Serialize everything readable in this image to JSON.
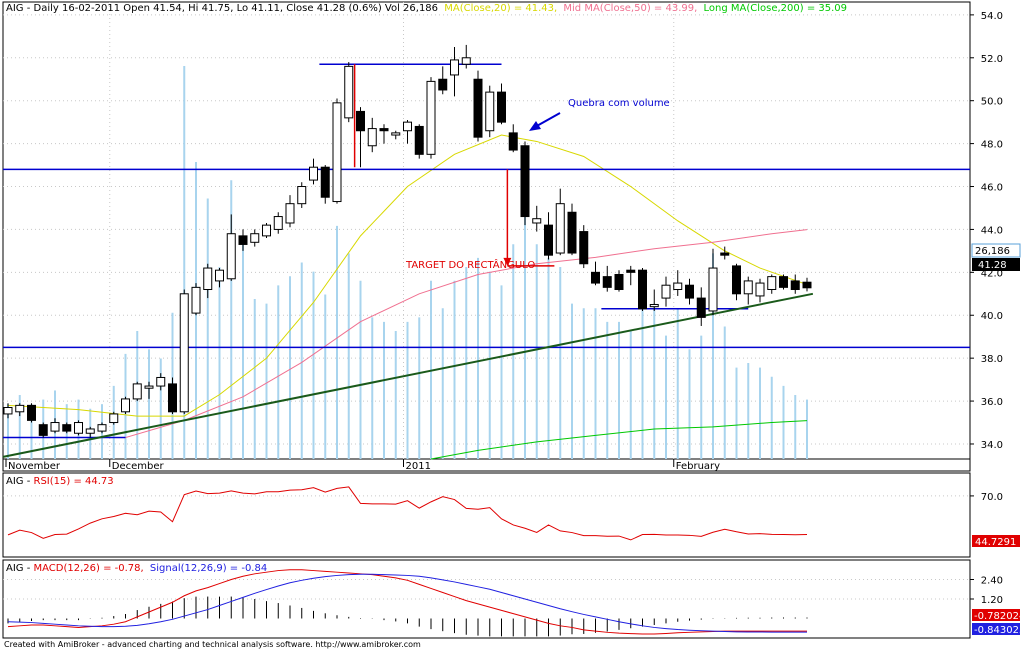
{
  "header": {
    "symbol": "AIG",
    "main_text": "AIG - Daily 16-02-2011 Open 41.54, Hi 41.75, Lo 41.11, Close 41.28 (0.6%) Vol 26,186",
    "ma_short_text": "MA(Close,20) = 41.43,",
    "ma_mid_text": "Mid MA(Close,50) = 43.99,",
    "ma_long_text": "Long MA(Close,200) = 35.09"
  },
  "colors": {
    "up_candle": "#ffffff",
    "down_candle": "#000000",
    "volume": "#a8d4ee",
    "ma_short": "#d8d800",
    "ma_mid": "#f07090",
    "ma_long": "#00c800",
    "levels": "#0000d0",
    "trendline": "#000000",
    "target": "#e00000",
    "rsi": "#e00000",
    "macd": "#e00000",
    "signal": "#2020e0",
    "value_bg_red": "#e00000",
    "value_bg_blue": "#2020e0",
    "value_bg_black": "#000000"
  },
  "annotations": {
    "breakout": "Quebra com volume",
    "target": "TARGET DO RECTÂNGULO"
  },
  "value_labels": {
    "volume": "26,186",
    "close": "41.28",
    "rsi": "44.7291",
    "macd": "-0.782024",
    "signal": "-0.843023"
  },
  "rsi_header": {
    "main": "AIG - ",
    "label": "RSI(15) = 44.73"
  },
  "macd_header": {
    "main": "AIG - ",
    "macd": "MACD(12,26) = -0.78,",
    "signal": "Signal(12,26,9) = -0.84"
  },
  "footer": "Created with AmiBroker - advanced charting and technical analysis software. http://www.amibroker.com",
  "chart_data": [
    {
      "type": "candlestick",
      "title": "AIG - Daily",
      "x_labels": [
        "November",
        "December",
        "2011",
        "February"
      ],
      "y_ticks": [
        34,
        36,
        38,
        40,
        42,
        44,
        46,
        48,
        50,
        52,
        54
      ],
      "ylim": [
        33.3,
        54.6
      ],
      "grid": true,
      "candles": [
        {
          "o": 35.4,
          "h": 35.9,
          "l": 35.2,
          "c": 35.7
        },
        {
          "o": 35.5,
          "h": 35.9,
          "l": 35.3,
          "c": 35.8
        },
        {
          "o": 35.8,
          "h": 35.9,
          "l": 35.0,
          "c": 35.1
        },
        {
          "o": 34.9,
          "h": 35.0,
          "l": 34.3,
          "c": 34.4
        },
        {
          "o": 34.6,
          "h": 35.2,
          "l": 34.5,
          "c": 35.0
        },
        {
          "o": 34.9,
          "h": 35.0,
          "l": 34.5,
          "c": 34.6
        },
        {
          "o": 34.5,
          "h": 35.1,
          "l": 34.4,
          "c": 35.0
        },
        {
          "o": 34.5,
          "h": 34.8,
          "l": 34.3,
          "c": 34.7
        },
        {
          "o": 34.6,
          "h": 35.0,
          "l": 34.5,
          "c": 34.9
        },
        {
          "o": 35.0,
          "h": 35.5,
          "l": 34.9,
          "c": 35.4
        },
        {
          "o": 35.5,
          "h": 36.2,
          "l": 35.4,
          "c": 36.1
        },
        {
          "o": 36.1,
          "h": 36.9,
          "l": 36.0,
          "c": 36.8
        },
        {
          "o": 36.6,
          "h": 36.9,
          "l": 36.1,
          "c": 36.7
        },
        {
          "o": 36.7,
          "h": 37.3,
          "l": 36.5,
          "c": 37.1
        },
        {
          "o": 36.8,
          "h": 37.1,
          "l": 35.4,
          "c": 35.5
        },
        {
          "o": 35.5,
          "h": 41.2,
          "l": 35.4,
          "c": 41.0
        },
        {
          "o": 40.1,
          "h": 41.5,
          "l": 40.0,
          "c": 41.3
        },
        {
          "o": 41.2,
          "h": 42.4,
          "l": 40.8,
          "c": 42.2
        },
        {
          "o": 41.6,
          "h": 42.2,
          "l": 41.3,
          "c": 42.1
        },
        {
          "o": 41.7,
          "h": 44.7,
          "l": 41.6,
          "c": 43.8
        },
        {
          "o": 43.7,
          "h": 44.0,
          "l": 43.0,
          "c": 43.3
        },
        {
          "o": 43.4,
          "h": 44.0,
          "l": 43.2,
          "c": 43.8
        },
        {
          "o": 43.7,
          "h": 44.3,
          "l": 43.6,
          "c": 44.2
        },
        {
          "o": 44.0,
          "h": 44.8,
          "l": 43.8,
          "c": 44.6
        },
        {
          "o": 44.3,
          "h": 45.6,
          "l": 44.1,
          "c": 45.2
        },
        {
          "o": 45.2,
          "h": 46.2,
          "l": 45.0,
          "c": 46.0
        },
        {
          "o": 46.3,
          "h": 47.3,
          "l": 46.1,
          "c": 46.9
        },
        {
          "o": 46.9,
          "h": 47.0,
          "l": 45.2,
          "c": 45.5
        },
        {
          "o": 45.3,
          "h": 50.1,
          "l": 45.2,
          "c": 49.9
        },
        {
          "o": 49.2,
          "h": 51.8,
          "l": 49.0,
          "c": 51.6
        },
        {
          "o": 49.5,
          "h": 49.7,
          "l": 46.9,
          "c": 48.6
        },
        {
          "o": 47.9,
          "h": 49.2,
          "l": 47.6,
          "c": 48.7
        },
        {
          "o": 48.7,
          "h": 48.9,
          "l": 48.0,
          "c": 48.6
        },
        {
          "o": 48.4,
          "h": 48.6,
          "l": 48.2,
          "c": 48.5
        },
        {
          "o": 48.6,
          "h": 49.1,
          "l": 48.0,
          "c": 49.0
        },
        {
          "o": 48.8,
          "h": 48.9,
          "l": 47.3,
          "c": 47.5
        },
        {
          "o": 47.5,
          "h": 51.1,
          "l": 47.3,
          "c": 50.9
        },
        {
          "o": 51.0,
          "h": 51.6,
          "l": 50.3,
          "c": 50.5
        },
        {
          "o": 51.2,
          "h": 52.5,
          "l": 50.2,
          "c": 51.9
        },
        {
          "o": 51.7,
          "h": 52.6,
          "l": 51.5,
          "c": 52.0
        },
        {
          "o": 51.0,
          "h": 51.4,
          "l": 48.1,
          "c": 48.3
        },
        {
          "o": 48.6,
          "h": 50.7,
          "l": 48.3,
          "c": 50.4
        },
        {
          "o": 50.4,
          "h": 50.8,
          "l": 48.9,
          "c": 49.0
        },
        {
          "o": 48.5,
          "h": 48.9,
          "l": 47.6,
          "c": 47.7
        },
        {
          "o": 47.9,
          "h": 48.1,
          "l": 44.2,
          "c": 44.6
        },
        {
          "o": 44.3,
          "h": 45.1,
          "l": 43.9,
          "c": 44.5
        },
        {
          "o": 44.2,
          "h": 44.8,
          "l": 42.6,
          "c": 42.8
        },
        {
          "o": 42.9,
          "h": 45.9,
          "l": 42.8,
          "c": 45.2
        },
        {
          "o": 44.8,
          "h": 45.2,
          "l": 42.8,
          "c": 42.9
        },
        {
          "o": 43.9,
          "h": 44.2,
          "l": 42.2,
          "c": 42.4
        },
        {
          "o": 42.0,
          "h": 42.5,
          "l": 41.4,
          "c": 41.5
        },
        {
          "o": 41.8,
          "h": 42.3,
          "l": 41.1,
          "c": 41.3
        },
        {
          "o": 41.9,
          "h": 42.1,
          "l": 41.1,
          "c": 41.2
        },
        {
          "o": 42.1,
          "h": 42.3,
          "l": 41.4,
          "c": 42.0
        },
        {
          "o": 42.1,
          "h": 42.2,
          "l": 40.2,
          "c": 40.3
        },
        {
          "o": 40.4,
          "h": 41.2,
          "l": 40.2,
          "c": 40.5
        },
        {
          "o": 40.8,
          "h": 41.8,
          "l": 40.4,
          "c": 41.4
        },
        {
          "o": 41.2,
          "h": 42.1,
          "l": 40.9,
          "c": 41.5
        },
        {
          "o": 41.4,
          "h": 41.7,
          "l": 40.5,
          "c": 40.8
        },
        {
          "o": 40.8,
          "h": 41.3,
          "l": 39.5,
          "c": 39.9
        },
        {
          "o": 40.2,
          "h": 43.1,
          "l": 40.0,
          "c": 42.2
        },
        {
          "o": 42.9,
          "h": 43.2,
          "l": 42.6,
          "c": 42.8
        },
        {
          "o": 42.3,
          "h": 42.4,
          "l": 40.7,
          "c": 41.0
        },
        {
          "o": 41.0,
          "h": 41.8,
          "l": 40.5,
          "c": 41.6
        },
        {
          "o": 40.9,
          "h": 41.7,
          "l": 40.6,
          "c": 41.5
        },
        {
          "o": 41.2,
          "h": 41.9,
          "l": 41.0,
          "c": 41.8
        },
        {
          "o": 41.8,
          "h": 41.9,
          "l": 41.2,
          "c": 41.3
        },
        {
          "o": 41.6,
          "h": 41.9,
          "l": 41.0,
          "c": 41.2
        },
        {
          "o": 41.54,
          "h": 41.75,
          "l": 41.11,
          "c": 41.28
        }
      ],
      "volume": [
        1.2,
        1.4,
        1.2,
        1.3,
        1.5,
        1.2,
        1.3,
        1.1,
        1.2,
        1.6,
        2.3,
        2.8,
        2.4,
        2.2,
        3.2,
        8.6,
        6.5,
        5.7,
        4.2,
        6.1,
        4.8,
        3.5,
        3.4,
        3.8,
        4.0,
        4.3,
        4.1,
        3.6,
        5.1,
        4.5,
        3.9,
        3.1,
        3.0,
        2.8,
        3.0,
        3.1,
        3.9,
        3.3,
        3.9,
        4.2,
        4.4,
        4.1,
        3.8,
        4.7,
        5.7,
        4.7,
        4.4,
        4.2,
        3.4,
        3.3,
        3.3,
        3.0,
        3.0,
        2.8,
        3.6,
        3.4,
        2.7,
        3.3,
        2.4,
        2.7,
        4.5,
        2.9,
        2.0,
        2.1,
        2.0,
        1.8,
        1.6,
        1.4,
        1.3
      ],
      "ma_short": [
        [
          0,
          35.8
        ],
        [
          6,
          35.6
        ],
        [
          11,
          35.3
        ],
        [
          15,
          35.3
        ],
        [
          18,
          36.3
        ],
        [
          22,
          38.0
        ],
        [
          26,
          40.6
        ],
        [
          30,
          43.7
        ],
        [
          34,
          46.0
        ],
        [
          38,
          47.5
        ],
        [
          42,
          48.4
        ],
        [
          45,
          48.1
        ],
        [
          49,
          47.4
        ],
        [
          53,
          46.0
        ],
        [
          57,
          44.4
        ],
        [
          61,
          43.0
        ],
        [
          64,
          42.2
        ],
        [
          68,
          41.43
        ]
      ],
      "ma_mid": [
        [
          10,
          34.3
        ],
        [
          15,
          35.1
        ],
        [
          20,
          36.2
        ],
        [
          25,
          37.8
        ],
        [
          30,
          39.7
        ],
        [
          35,
          41.0
        ],
        [
          40,
          41.9
        ],
        [
          45,
          42.4
        ],
        [
          50,
          42.7
        ],
        [
          55,
          43.1
        ],
        [
          60,
          43.4
        ],
        [
          65,
          43.8
        ],
        [
          68,
          43.99
        ]
      ],
      "ma_long": [
        [
          36,
          33.3
        ],
        [
          40,
          33.7
        ],
        [
          45,
          34.1
        ],
        [
          50,
          34.4
        ],
        [
          55,
          34.7
        ],
        [
          60,
          34.8
        ],
        [
          65,
          35.0
        ],
        [
          68,
          35.09
        ]
      ],
      "levels": [
        {
          "name": "upper rectangle",
          "value": 51.7,
          "x0": 26.5,
          "x1": 42
        },
        {
          "name": "resistance",
          "value": 46.8,
          "x0": 0,
          "x1": 82
        },
        {
          "name": "support",
          "value": 38.5,
          "x0": 0,
          "x1": 82
        },
        {
          "name": "lower box",
          "value": 40.3,
          "x0": 50.5,
          "x1": 63
        },
        {
          "name": "november base",
          "value": 34.3,
          "x0": 0,
          "x1": 10
        }
      ],
      "trendline": {
        "x0": 0,
        "y0": 33.4,
        "x1": 68.5,
        "y1": 41.0
      },
      "target_lines": [
        {
          "type": "height",
          "x": 29.5,
          "y0": 51.7,
          "y1": 46.9
        },
        {
          "type": "projection",
          "x": 42.5,
          "y0": 46.8,
          "y1": 42.3,
          "x_end": 46.5
        }
      ]
    },
    {
      "type": "line",
      "title": "RSI(15)",
      "y_ticks": [
        70
      ],
      "series": [
        {
          "name": "RSI(15)",
          "values": [
            44.5,
            47.6,
            46.0,
            42.2,
            44.7,
            45.0,
            48.4,
            52.2,
            55.0,
            56.5,
            58.6,
            57.7,
            60.0,
            59.5,
            53.1,
            70.8,
            73.2,
            71.5,
            71.8,
            73.3,
            71.8,
            71.3,
            72.7,
            72.7,
            73.8,
            74.0,
            75.4,
            72.5,
            74.9,
            75.9,
            65.1,
            64.8,
            64.8,
            64.6,
            66.9,
            62.0,
            66.1,
            69.5,
            67.6,
            61.8,
            61.3,
            62.3,
            55.0,
            51.0,
            48.8,
            46.1,
            51.0,
            47.1,
            46.0,
            44.0,
            44.0,
            43.6,
            43.7,
            41.2,
            44.7,
            44.8,
            44.4,
            44.4,
            44.2,
            43.5,
            46.2,
            48.2,
            46.5,
            45.1,
            45.3,
            44.8,
            44.7,
            44.6,
            44.73
          ]
        }
      ]
    },
    {
      "type": "line",
      "title": "MACD(12,26)",
      "y_ticks": [
        2.4,
        1.2
      ],
      "series": [
        {
          "name": "MACD(12,26)",
          "values": [
            -0.5,
            -0.45,
            -0.4,
            -0.4,
            -0.45,
            -0.5,
            -0.55,
            -0.5,
            -0.45,
            -0.35,
            -0.2,
            0.1,
            0.4,
            0.7,
            1.0,
            1.4,
            1.7,
            1.9,
            2.15,
            2.4,
            2.6,
            2.75,
            2.85,
            2.95,
            3.0,
            3.0,
            2.95,
            2.9,
            2.85,
            2.8,
            2.75,
            2.7,
            2.6,
            2.5,
            2.35,
            2.1,
            1.85,
            1.6,
            1.35,
            1.1,
            0.9,
            0.7,
            0.5,
            0.3,
            0.1,
            -0.1,
            -0.3,
            -0.45,
            -0.55,
            -0.7,
            -0.78,
            -0.85,
            -0.9,
            -0.93,
            -0.95,
            -0.95,
            -0.92,
            -0.88,
            -0.85,
            -0.82,
            -0.8,
            -0.78,
            -0.78,
            -0.78,
            -0.78,
            -0.78,
            -0.78,
            -0.78,
            -0.78
          ]
        },
        {
          "name": "Signal(12,26,9)",
          "values": [
            -0.2,
            -0.22,
            -0.25,
            -0.3,
            -0.35,
            -0.4,
            -0.45,
            -0.48,
            -0.5,
            -0.5,
            -0.48,
            -0.42,
            -0.32,
            -0.2,
            -0.05,
            0.15,
            0.35,
            0.55,
            0.8,
            1.05,
            1.3,
            1.55,
            1.78,
            2.0,
            2.2,
            2.35,
            2.48,
            2.58,
            2.65,
            2.7,
            2.72,
            2.72,
            2.7,
            2.68,
            2.65,
            2.6,
            2.5,
            2.38,
            2.25,
            2.1,
            1.95,
            1.8,
            1.6,
            1.4,
            1.2,
            1.0,
            0.8,
            0.6,
            0.42,
            0.25,
            0.1,
            -0.05,
            -0.2,
            -0.33,
            -0.45,
            -0.55,
            -0.62,
            -0.68,
            -0.72,
            -0.75,
            -0.78,
            -0.8,
            -0.82,
            -0.83,
            -0.83,
            -0.84,
            -0.84,
            -0.84,
            -0.84
          ]
        }
      ]
    }
  ]
}
